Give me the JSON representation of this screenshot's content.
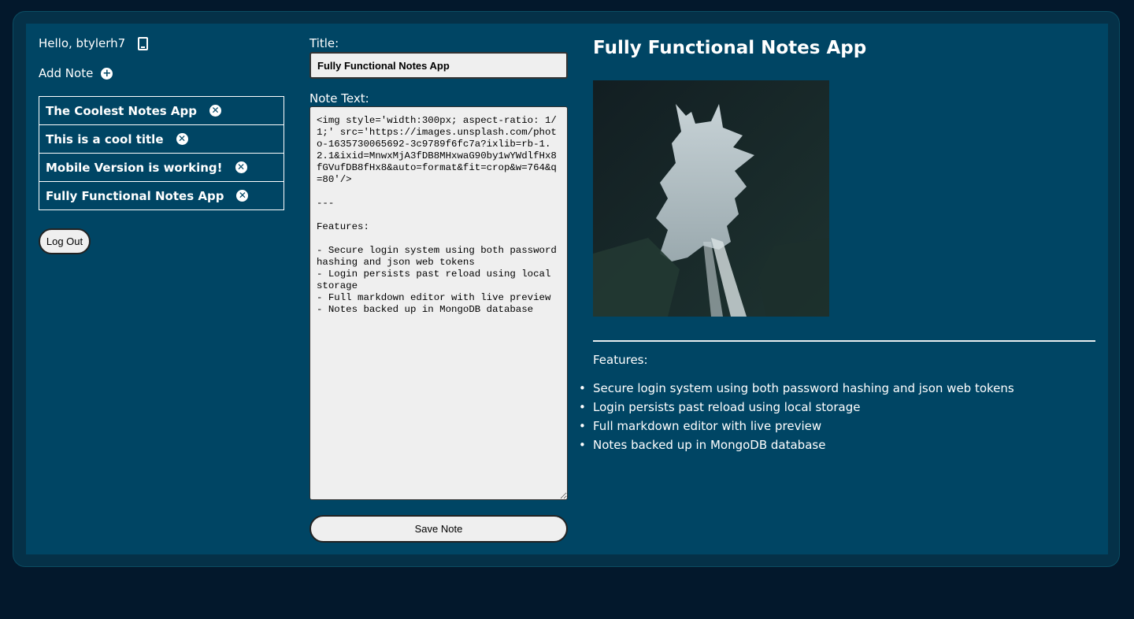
{
  "sidebar": {
    "greeting": "Hello, btylerh7",
    "tablet_icon": "tablet-icon",
    "add_note_label": "Add Note",
    "add_icon": "plus-circle-icon",
    "notes": [
      {
        "title": "The Coolest Notes App"
      },
      {
        "title": "This is a cool title"
      },
      {
        "title": "Mobile Version is working!"
      },
      {
        "title": "Fully Functional Notes App"
      }
    ],
    "delete_icon": "x-circle-icon",
    "logout_label": "Log Out"
  },
  "editor": {
    "title_label": "Title:",
    "title_value": "Fully Functional Notes App",
    "text_label": "Note Text:",
    "text_value": "<img style='width:300px; aspect-ratio: 1/1;' src='https://images.unsplash.com/photo-1635730065692-3c9789f6fc7a?ixlib=rb-1.2.1&ixid=MnwxMjA3fDB8MHxwaG90by1wYWdlfHx8fGVufDB8fHx8&auto=format&fit=crop&w=764&q=80'/>\n\n---\n\nFeatures:\n\n- Secure login system using both password hashing and json web tokens\n- Login persists past reload using local storage\n- Full markdown editor with live preview\n- Notes backed up in MongoDB database",
    "save_label": "Save Note"
  },
  "preview": {
    "title": "Fully Functional Notes App",
    "features_label": "Features:",
    "features": [
      "Secure login system using both password hashing and json web tokens",
      "Login persists past reload using local storage",
      "Full markdown editor with live preview",
      "Notes backed up in MongoDB database"
    ]
  },
  "colors": {
    "page_bg": "#03182c",
    "panel_bg": "#004564",
    "frame_bg": "#053148"
  }
}
